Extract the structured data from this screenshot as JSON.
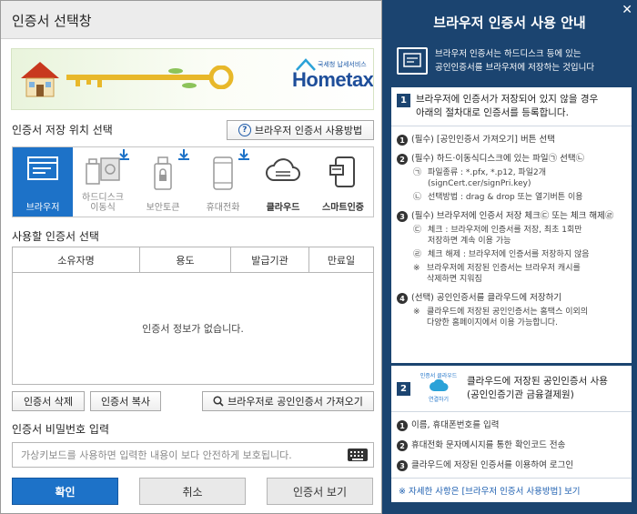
{
  "window": {
    "title": "인증서 선택창"
  },
  "banner": {
    "logo_small": "국세청 납세서비스",
    "logo_text": "Hometax."
  },
  "location": {
    "section_label": "인증서 저장 위치 선택",
    "help_button": "브라우저 인증서 사용방법",
    "items": [
      {
        "label": "브라우저",
        "active": true,
        "icon": "browser-icon"
      },
      {
        "label": "하드디스크\n이동식",
        "active": false,
        "icon": "usb-disk-icon"
      },
      {
        "label": "보안토큰",
        "active": false,
        "icon": "security-token-icon"
      },
      {
        "label": "휴대전화",
        "active": false,
        "icon": "mobile-phone-icon"
      },
      {
        "label": "클라우드",
        "active": false,
        "icon": "cloud-icon"
      },
      {
        "label": "스마트인증",
        "active": false,
        "icon": "smart-card-icon"
      }
    ]
  },
  "certificates": {
    "section_label": "사용할 인증서 선택",
    "columns": [
      "소유자명",
      "용도",
      "발급기관",
      "만료일"
    ],
    "empty_message": "인증서 정보가 없습니다."
  },
  "actions": {
    "delete": "인증서 삭제",
    "copy": "인증서 복사",
    "import": "브라우저로 공인인증서 가져오기"
  },
  "password": {
    "section_label": "인증서 비밀번호 입력",
    "placeholder": "가상키보드를 사용하면 입력한 내용이 보다 안전하게 보호됩니다."
  },
  "buttons": {
    "ok": "확인",
    "cancel": "취소",
    "view": "인증서 보기"
  },
  "guide": {
    "title": "브라우저 인증서 사용 안내",
    "intro_line1": "브라우저 인증서는 하드디스크 등에 있는",
    "intro_line2": "공인인증서를 브라우저에 저장하는 것입니다",
    "step1": {
      "num": "1",
      "title_line1": "브라우저에 인증서가 저장되어 있지 않을 경우",
      "title_line2": "아래의 절차대로 인증서를 등록합니다.",
      "i1": "(필수) [공인인증서 가져오기] 버튼 선택",
      "i2": "(필수) 하드·이동식디스크에 있는 파일㉠ 선택㉡",
      "i2_a_mark": "㉠",
      "i2_a_line1": "파일종류 : *.pfx, *.p12, 파일2개",
      "i2_a_line2": "(signCert.cer/signPri.key)",
      "i2_b_mark": "㉡",
      "i2_b": "선택방법 : drag & drop 또는 열기버튼 이용",
      "i3": "(필수) 브라우저에 인증서 저장 체크㉢ 또는 체크 해제㉣",
      "i3_a_mark": "㉢",
      "i3_a_line1": "체크 : 브라우저에 인증서를 저장, 최초 1회만",
      "i3_a_line2": "저장하면 계속 이용 가능",
      "i3_b_mark": "㉣",
      "i3_b": "체크 해제 : 브라우저에 인증서를 저장하지 않음",
      "i3_note_line1": "브라우저에 저장된 인증서는 브라우저 캐시를",
      "i3_note_line2": "삭제하면 지워짐",
      "i4": "(선택) 공인인증서를 클라우드에 저장하기",
      "i4_note_line1": "클라우드에 저장된 공인인증서는 홈택스 이외의",
      "i4_note_line2": "다양한 홈페이지에서 이용 가능합니다."
    },
    "step2": {
      "num": "2",
      "icon_top": "인증서 클라우드",
      "icon_bottom": "연결하기",
      "title_line1": "클라우드에 저장된 공인인증서 사용",
      "title_line2": "(공인인증기관 금융결제원)",
      "i1": "이름, 휴대폰번호를 입력",
      "i2": "휴대전화 문자메시지를 통한 확인코드 전송",
      "i3": "클라우드에 저장된 인증서를 이용하여 로그인"
    },
    "bottom_note": "※ 자세한 사항은 [브라우저 인증서 사용방법] 보기"
  },
  "colors": {
    "accent": "#1d72c8",
    "panel": "#1b4470"
  }
}
